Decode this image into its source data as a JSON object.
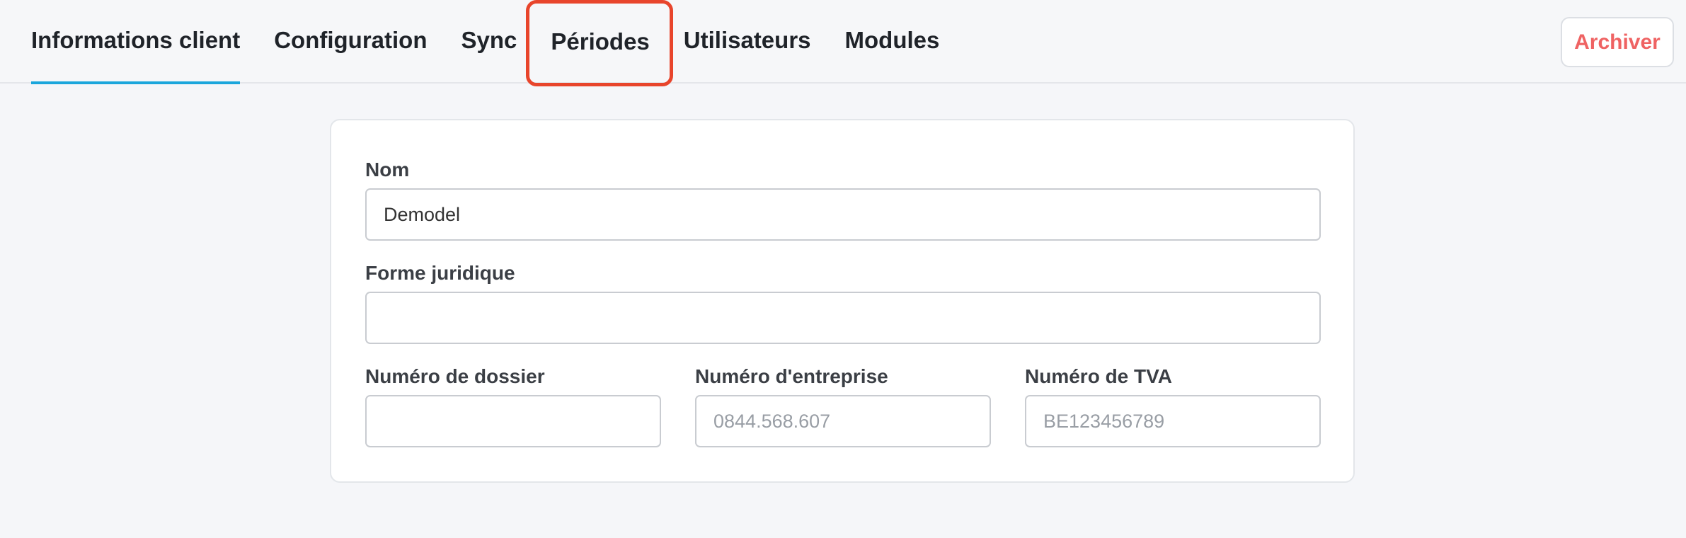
{
  "tabs": [
    {
      "label": "Informations client"
    },
    {
      "label": "Configuration"
    },
    {
      "label": "Sync"
    },
    {
      "label": "Périodes"
    },
    {
      "label": "Utilisateurs"
    },
    {
      "label": "Modules"
    }
  ],
  "archive_button": {
    "label": "Archiver"
  },
  "form": {
    "name": {
      "label": "Nom",
      "value": "Demodel"
    },
    "legal_form": {
      "label": "Forme juridique",
      "value": ""
    },
    "file_number": {
      "label": "Numéro de dossier",
      "value": ""
    },
    "company_number": {
      "label": "Numéro d'entreprise",
      "placeholder": "0844.568.607"
    },
    "vat_number": {
      "label": "Numéro de TVA",
      "placeholder": "BE123456789"
    }
  },
  "colors": {
    "active_tab_underline": "#1aa6dc",
    "highlight_box": "#e8452c",
    "archive_text": "#ef6363"
  }
}
